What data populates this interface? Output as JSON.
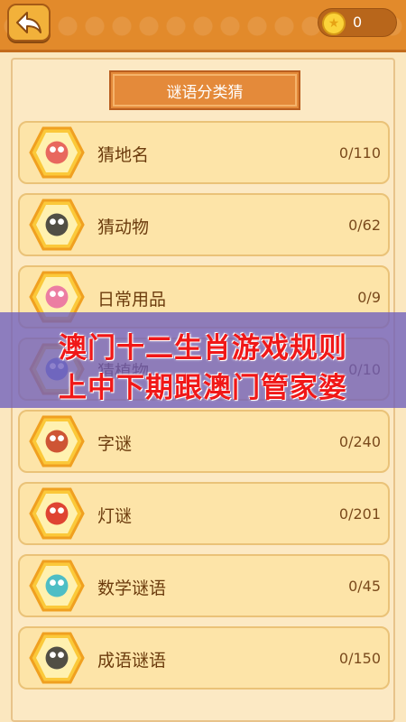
{
  "header": {
    "back_icon": "back-arrow-icon",
    "coins": "0"
  },
  "panel": {
    "title": "谜语分类猜"
  },
  "categories": [
    {
      "label": "猜地名",
      "count": "0/110",
      "icon": "map-pin-icon",
      "color": "#e45050"
    },
    {
      "label": "猜动物",
      "count": "0/62",
      "icon": "panda-icon",
      "color": "#333333"
    },
    {
      "label": "日常用品",
      "count": "0/9",
      "icon": "daily-goods-icon",
      "color": "#e96aa0"
    },
    {
      "label": "猜植物",
      "count": "0/10",
      "icon": "plant-icon",
      "color": "#5b6fc4"
    },
    {
      "label": "字谜",
      "count": "0/240",
      "icon": "character-icon",
      "color": "#c63a1e"
    },
    {
      "label": "灯谜",
      "count": "0/201",
      "icon": "lantern-icon",
      "color": "#d9261c"
    },
    {
      "label": "数学谜语",
      "count": "0/45",
      "icon": "math-cloud-icon",
      "color": "#2fb5c9"
    },
    {
      "label": "成语谜语",
      "count": "0/150",
      "icon": "idiom-icon",
      "color": "#333333"
    }
  ],
  "banner": {
    "line1": "澳门十二生肖游戏规则",
    "line2": "上中下期跟澳门管家婆"
  },
  "colors": {
    "accent": "#e28a2b",
    "hex_fill": "#fbc93a",
    "banner_text": "#f01818"
  }
}
